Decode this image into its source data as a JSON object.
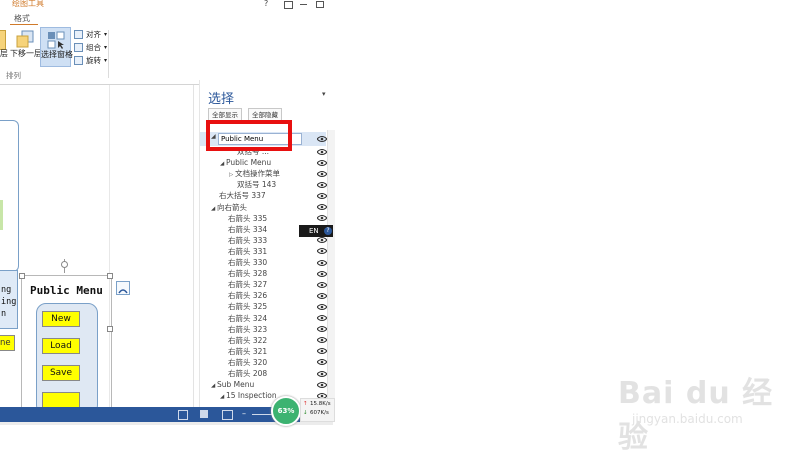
{
  "ribbon": {
    "context_title": "绘图工具",
    "context_tab": "格式",
    "window_help": "?",
    "buttons": [
      {
        "label": "层"
      },
      {
        "label": "下移一层"
      },
      {
        "label": "选择窗格"
      }
    ],
    "small_items": [
      "对齐",
      "组合",
      "旋转"
    ],
    "group_label": "排列"
  },
  "canvas": {
    "left_labels": [
      "ng",
      "ing",
      "n"
    ],
    "left_yellow_label": "ne",
    "container_title": "Public Menu",
    "yellow_buttons": [
      "New",
      "Load",
      "Save"
    ]
  },
  "pane": {
    "title": "选择",
    "show_all": "全部显示",
    "hide_all": "全部隐藏",
    "edit_value": "Public Menu",
    "items": [
      {
        "text": "双括号 ...",
        "indent": 2,
        "arrow": ""
      },
      {
        "text": "Public Menu",
        "indent": 1,
        "arrow": "◢"
      },
      {
        "text": "文档操作菜单",
        "indent": 2,
        "arrow": "▷"
      },
      {
        "text": "双括号 143",
        "indent": 2,
        "arrow": ""
      },
      {
        "text": "右大括号 337",
        "indent": 0,
        "arrow": ""
      },
      {
        "text": "向右箭头",
        "indent": 0,
        "arrow": "◢"
      },
      {
        "text": "右箭头 335",
        "indent": 1,
        "arrow": ""
      },
      {
        "text": "右箭头 334",
        "indent": 1,
        "arrow": ""
      },
      {
        "text": "右箭头 333",
        "indent": 1,
        "arrow": ""
      },
      {
        "text": "右箭头 331",
        "indent": 1,
        "arrow": ""
      },
      {
        "text": "右箭头 330",
        "indent": 1,
        "arrow": ""
      },
      {
        "text": "右箭头 328",
        "indent": 1,
        "arrow": ""
      },
      {
        "text": "右箭头 327",
        "indent": 1,
        "arrow": ""
      },
      {
        "text": "右箭头 326",
        "indent": 1,
        "arrow": ""
      },
      {
        "text": "右箭头 325",
        "indent": 1,
        "arrow": ""
      },
      {
        "text": "右箭头 324",
        "indent": 1,
        "arrow": ""
      },
      {
        "text": "右箭头 323",
        "indent": 1,
        "arrow": ""
      },
      {
        "text": "右箭头 322",
        "indent": 1,
        "arrow": ""
      },
      {
        "text": "右箭头 321",
        "indent": 1,
        "arrow": ""
      },
      {
        "text": "右箭头 320",
        "indent": 1,
        "arrow": ""
      },
      {
        "text": "右箭头 208",
        "indent": 1,
        "arrow": ""
      },
      {
        "text": "Sub Menu",
        "indent": 0,
        "arrow": "◢"
      },
      {
        "text": "15 Inspection ...",
        "indent": 1,
        "arrow": "◢"
      }
    ]
  },
  "ime": {
    "label": "EN"
  },
  "status": {
    "zoom_badge": "63%",
    "net_up": "15.8K/s",
    "net_down": "607K/s"
  },
  "watermark": {
    "text": "Bai du 经验",
    "url": "jingyan.baidu.com"
  },
  "colors": {
    "accent": "#2b579a",
    "highlight": "#e81010",
    "yellow": "#ffff00",
    "badge": "#3cb371"
  }
}
